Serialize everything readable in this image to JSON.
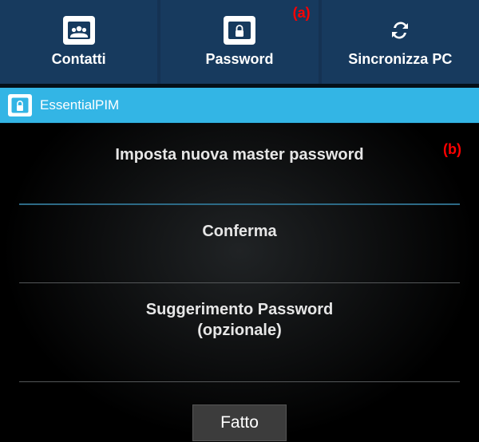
{
  "toolbar": {
    "items": [
      {
        "label": "Contatti",
        "icon": "contacts-icon"
      },
      {
        "label": "Password",
        "icon": "lock-icon"
      },
      {
        "label": "Sincronizza PC",
        "icon": "sync-icon"
      }
    ]
  },
  "markers": {
    "a": "(a)",
    "b": "(b)"
  },
  "titlebar": {
    "app_name": "EssentialPIM"
  },
  "form": {
    "master_password_label": "Imposta nuova master password",
    "confirm_label": "Conferma",
    "hint_label_line1": "Suggerimento Password",
    "hint_label_line2": "(opzionale)",
    "done_label": "Fatto"
  }
}
